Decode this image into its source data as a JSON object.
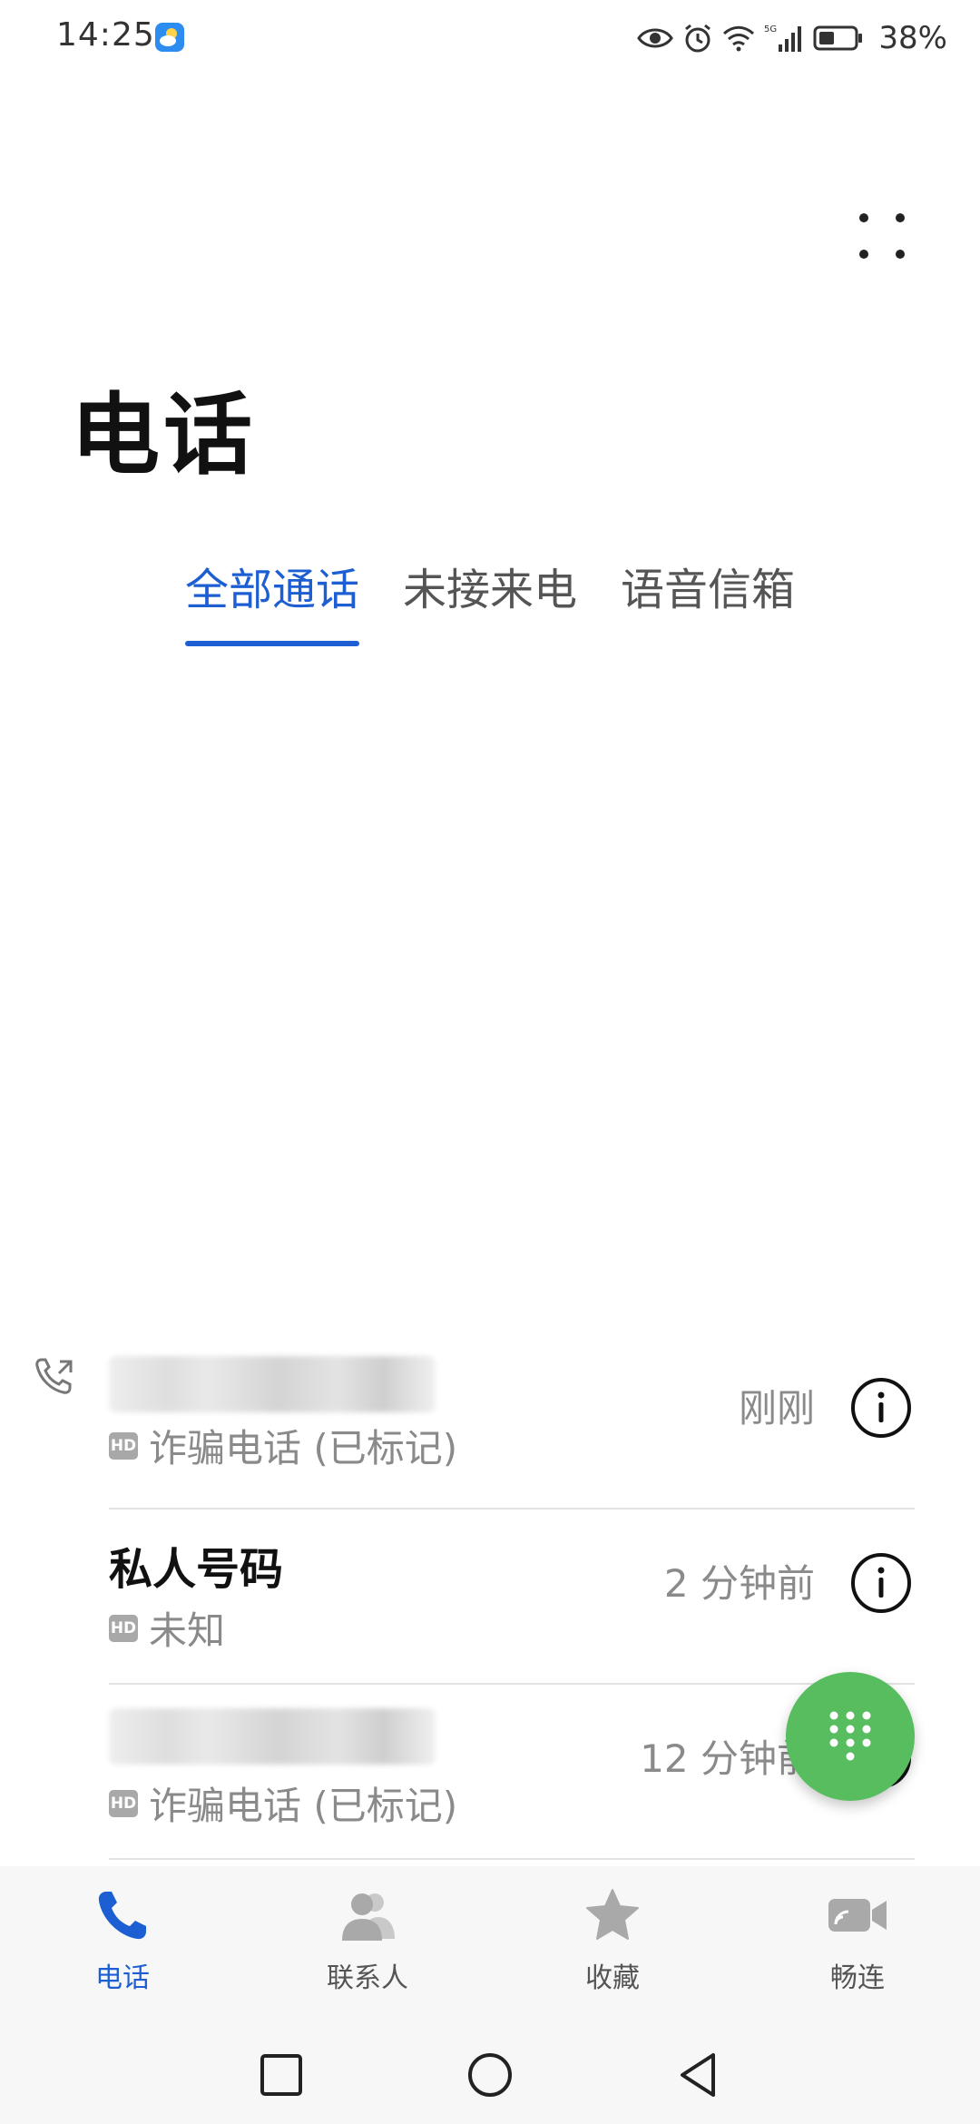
{
  "status_bar": {
    "time": "14:25",
    "battery": "38%",
    "network": "5G",
    "icons": [
      "weather-icon",
      "eye-icon",
      "alarm-icon",
      "wifi-icon",
      "signal-icon",
      "battery-icon"
    ]
  },
  "header": {
    "title": "电话",
    "more_icon": "more-dots-icon"
  },
  "tabs": [
    {
      "label": "全部通话",
      "active": true
    },
    {
      "label": "未接来电",
      "active": false
    },
    {
      "label": "语音信箱",
      "active": false
    }
  ],
  "calls": [
    {
      "name": "",
      "name_obscured": true,
      "hd": "HD",
      "description": "诈骗电话 (已标记)",
      "time": "刚刚",
      "direction": "outgoing"
    },
    {
      "name": "私人号码",
      "name_obscured": false,
      "hd": "HD",
      "description": "未知",
      "time": "2 分钟前"
    },
    {
      "name": "",
      "name_obscured": true,
      "hd": "HD",
      "description": "诈骗电话 (已标记)",
      "time": "12 分钟前"
    }
  ],
  "bottom_nav": [
    {
      "label": "电话",
      "icon": "phone-icon",
      "active": true
    },
    {
      "label": "联系人",
      "icon": "contacts-icon",
      "active": false
    },
    {
      "label": "收藏",
      "icon": "star-icon",
      "active": false
    },
    {
      "label": "畅连",
      "icon": "video-call-icon",
      "active": false
    }
  ],
  "colors": {
    "accent": "#1d5fd2",
    "fab": "#57bd5e",
    "secondary_text": "#8a8a8a"
  }
}
